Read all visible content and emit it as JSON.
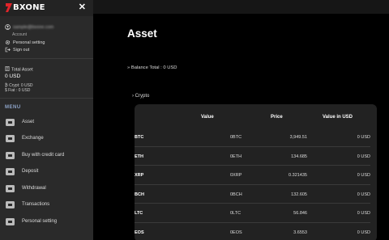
{
  "brand": {
    "name": "BXONE",
    "logo_color": "#e0242a"
  },
  "sidebar": {
    "account_email": "sample@bxone.com",
    "account_label": "Account",
    "personal_setting": "Personal setting",
    "sign_out": "Sign out",
    "total_asset_label": "Total Asset",
    "total_asset_value": "0 USD",
    "crypt_line": "Crypt: 0 USD",
    "fiat_line": "Fiat : 0 USD",
    "menu_title": "MENU",
    "menu_items": [
      {
        "label": "Asset",
        "icon": "wallet-icon"
      },
      {
        "label": "Exchange",
        "icon": "cart-icon"
      },
      {
        "label": "Buy with credit card",
        "icon": "cart-icon"
      },
      {
        "label": "Deposit",
        "icon": "deposit-icon"
      },
      {
        "label": "Withdrawal",
        "icon": "chart-icon"
      },
      {
        "label": "Transactions",
        "icon": "transactions-icon"
      },
      {
        "label": "Personal setting",
        "icon": "profile-icon"
      }
    ]
  },
  "main": {
    "title": "Asset",
    "balance_total": "Balance Total : 0 USD",
    "section_crypto": "Crypto",
    "table": {
      "headers": {
        "value": "Value",
        "price": "Price",
        "usd": "Value in USD"
      },
      "rows": [
        {
          "symbol": "BTC",
          "value": "0BTC",
          "price": "3,949.51",
          "usd": "0 USD"
        },
        {
          "symbol": "ETH",
          "value": "0ETH",
          "price": "134.685",
          "usd": "0 USD"
        },
        {
          "symbol": "XRP",
          "value": "0XRP",
          "price": "0.321435",
          "usd": "0 USD"
        },
        {
          "symbol": "BCH",
          "value": "0BCH",
          "price": "132.605",
          "usd": "0 USD"
        },
        {
          "symbol": "LTC",
          "value": "0LTC",
          "price": "56.846",
          "usd": "0 USD"
        },
        {
          "symbol": "EOS",
          "value": "0EOS",
          "price": "3.6553",
          "usd": "0 USD"
        }
      ]
    }
  }
}
